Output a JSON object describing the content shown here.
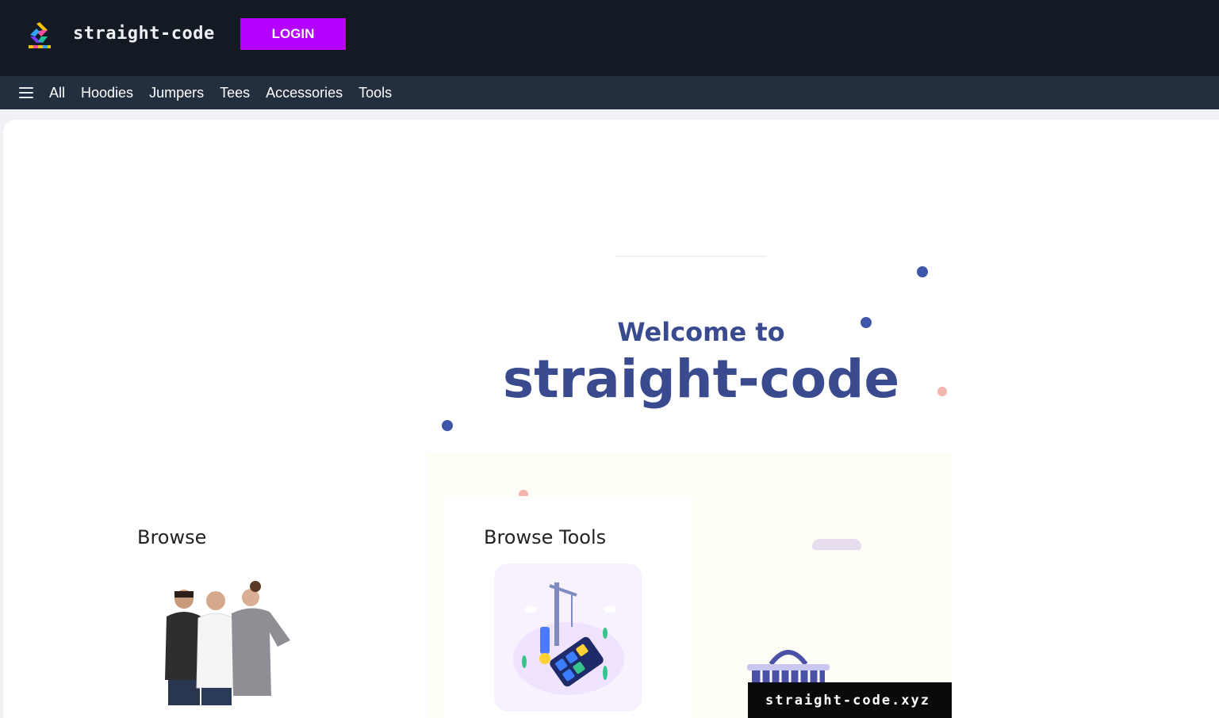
{
  "header": {
    "brand": "straight-code",
    "login_label": "LOGIN",
    "logo_icon": "straight-code-logo-icon"
  },
  "nav": {
    "menu_icon": "hamburger-menu-icon",
    "items": [
      {
        "label": "All"
      },
      {
        "label": "Hoodies"
      },
      {
        "label": "Jumpers"
      },
      {
        "label": "Tees"
      },
      {
        "label": "Accessories"
      },
      {
        "label": "Tools"
      }
    ]
  },
  "hero": {
    "welcome": "Welcome to",
    "title": "straight-code",
    "domain": "straight-code.xyz"
  },
  "sections": {
    "browse": "Browse",
    "browse_tools": "Browse Tools"
  },
  "colors": {
    "header_bg": "#131a23",
    "nav_bg": "#232f3e",
    "login_bg": "#b400ff",
    "hero_text": "#3a4a8e",
    "accent_dot": "#3f57a8",
    "pink_dot": "#f3b6ad"
  }
}
